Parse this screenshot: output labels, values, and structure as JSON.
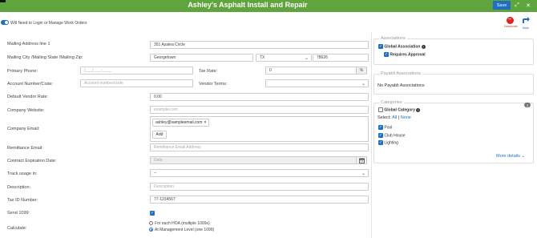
{
  "header": {
    "title": "Ashley's Asphalt Install and Repair",
    "save_label": "Save",
    "expand_icon": "⤢",
    "close_icon": "✕"
  },
  "toggle": {
    "label": "Will Need to Login or Manage Work Orders",
    "on": true
  },
  "actions": {
    "deactivate_label": "Deactivate",
    "back_label": "Back"
  },
  "form": {
    "mailing_address": {
      "label": "Mailing Address line 1",
      "value": "351 Azalea Circle"
    },
    "city_state_zip": {
      "label": "Mailing City /Mailing State /Mailing Zip:",
      "city": "Georgetown",
      "state": "TX",
      "zip": "78626"
    },
    "primary_phone": {
      "label": "Primary Phone:",
      "placeholder": "(___) ___-____"
    },
    "tax_rate": {
      "label": "Tax Rate:",
      "value": "0",
      "unit": "%"
    },
    "account_number": {
      "label": "Account Number/Code:",
      "placeholder": "Account number/code"
    },
    "vendor_terms": {
      "label": "Vendor Terms:",
      "value": ""
    },
    "default_vendor_rate": {
      "label": "Default Vendor Rate:",
      "value": "0.00"
    },
    "company_website": {
      "label": "Company Website:",
      "placeholder": "example.com"
    },
    "company_email": {
      "label": "Company Email:",
      "tag": "ashley@sampleemail.com",
      "tag_remove": "×",
      "add_label": "Add"
    },
    "remittance_email": {
      "label": "Remittance Email:",
      "placeholder": "Remittance Email Address"
    },
    "contract_expiration": {
      "label": "Contract Expiration Date:",
      "placeholder": "Date"
    },
    "track_usage": {
      "label": "Track usage in:",
      "value": "--"
    },
    "description": {
      "label": "Description:",
      "placeholder": "Description"
    },
    "tax_id": {
      "label": "Tax ID Number:",
      "value": "77-1234567"
    },
    "send_1099": {
      "label": "Send 1099:",
      "checked": true
    },
    "calculate": {
      "label": "Calculate:",
      "options": [
        "For each HOA (multiple 1099s)",
        "At Management Level (one 1099)"
      ],
      "selected": 1
    }
  },
  "associations": {
    "title": "Associations",
    "global_label": "Global Association",
    "requires_approval_label": "Requires Approval"
  },
  "payabli": {
    "title": "Payabli Associations",
    "empty_text": "No Payabli Associations"
  },
  "categories": {
    "title": "Categories",
    "count": "3",
    "global_label": "Global Category",
    "select_label": "Select:",
    "all_label": "All",
    "separator": "|",
    "none_label": "None",
    "items": [
      "Pool",
      "Club House",
      "Lighting"
    ],
    "more_label": "More details"
  },
  "colors": {
    "header_bg": "#5fa43c",
    "accent": "#1f6fc0",
    "danger": "#e0241b"
  }
}
